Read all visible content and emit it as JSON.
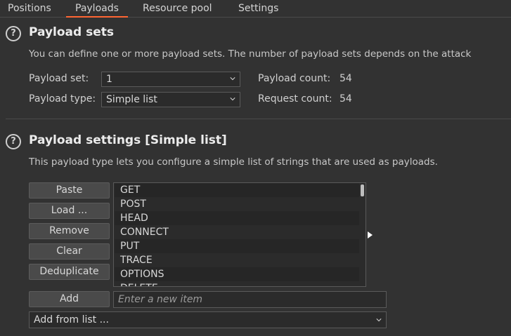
{
  "tabs": [
    {
      "label": "Positions"
    },
    {
      "label": "Payloads"
    },
    {
      "label": "Resource pool"
    },
    {
      "label": "Settings"
    }
  ],
  "payload_sets": {
    "title": "Payload sets",
    "description": "You can define one or more payload sets. The number of payload sets depends on the attack",
    "set_label": "Payload set:",
    "set_value": "1",
    "type_label": "Payload type:",
    "type_value": "Simple list",
    "payload_count_label": "Payload count:",
    "payload_count": "54",
    "request_count_label": "Request count:",
    "request_count": "54"
  },
  "payload_settings": {
    "title": "Payload settings [Simple list]",
    "description": "This payload type lets you configure a simple list of strings that are used as payloads.",
    "buttons": {
      "paste": "Paste",
      "load": "Load ...",
      "remove": "Remove",
      "clear": "Clear",
      "deduplicate": "Deduplicate",
      "add": "Add"
    },
    "items": [
      "GET",
      "POST",
      "HEAD",
      "CONNECT",
      "PUT",
      "TRACE",
      "OPTIONS",
      "DELETE"
    ],
    "add_placeholder": "Enter a new item",
    "add_from_list": "Add from list ..."
  },
  "colors": {
    "accent": "#ff6633",
    "background": "#323232"
  }
}
